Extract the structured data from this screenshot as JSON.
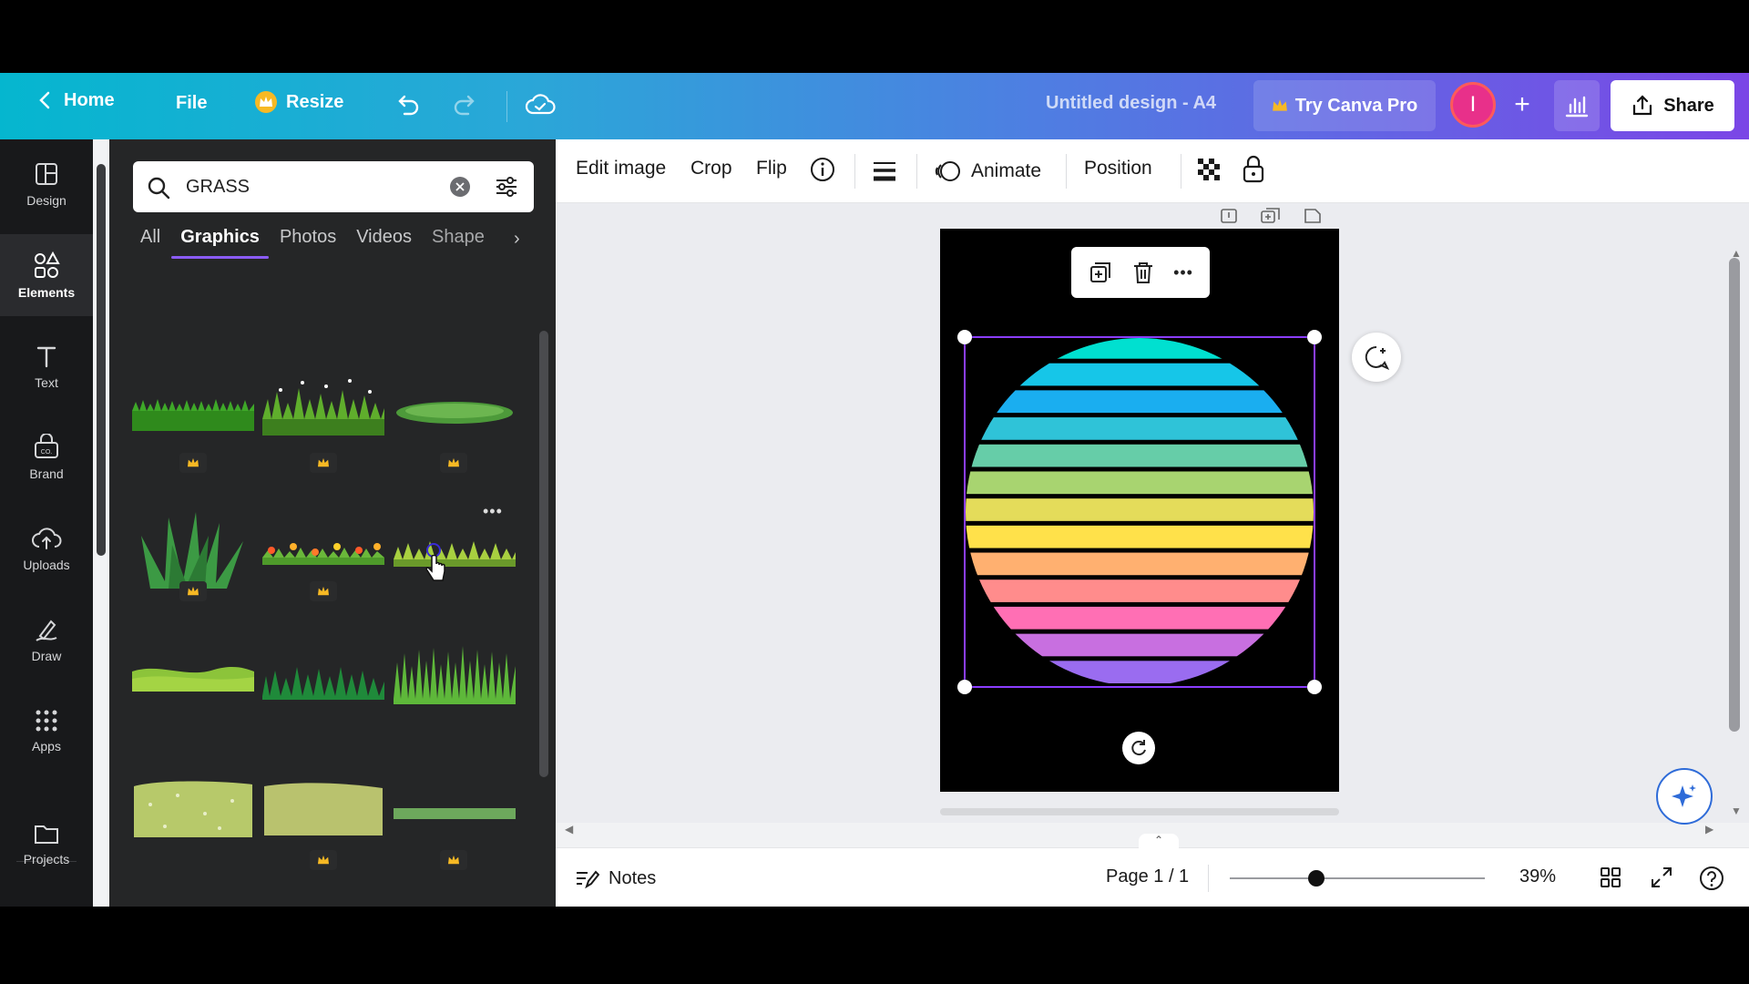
{
  "topbar": {
    "back_label": "Home",
    "file_label": "File",
    "resize_label": "Resize",
    "design_title": "Untitled design - A4",
    "try_pro_label": "Try Canva Pro",
    "avatar_initial": "I",
    "share_label": "Share"
  },
  "rail": {
    "items": [
      {
        "label": "Design",
        "icon": "layout-icon"
      },
      {
        "label": "Elements",
        "icon": "shapes-icon"
      },
      {
        "label": "Text",
        "icon": "text-icon"
      },
      {
        "label": "Brand",
        "icon": "brand-icon"
      },
      {
        "label": "Uploads",
        "icon": "upload-cloud-icon"
      },
      {
        "label": "Draw",
        "icon": "pen-icon"
      },
      {
        "label": "Apps",
        "icon": "grid-icon"
      },
      {
        "label": "Projects",
        "icon": "folder-icon"
      }
    ]
  },
  "panel": {
    "search_value": "GRASS",
    "tabs": [
      "All",
      "Graphics",
      "Photos",
      "Videos",
      "Shape"
    ],
    "active_tab": "Graphics"
  },
  "context_toolbar": {
    "edit_image": "Edit image",
    "crop": "Crop",
    "flip": "Flip",
    "animate": "Animate",
    "position": "Position"
  },
  "bottombar": {
    "notes_label": "Notes",
    "page_indicator": "Page 1 / 1",
    "zoom_value": "39%",
    "zoom_fraction": 0.39
  },
  "colors": {
    "accent": "#8b3dff",
    "topbar_start": "#05b6cf",
    "topbar_end": "#7b46e6",
    "panel_bg": "#252627",
    "stripes": [
      "#00e0d0",
      "#16c6e8",
      "#1aaef0",
      "#2fc3d8",
      "#66cda8",
      "#a8d470",
      "#e4dc5a",
      "#ffe14a",
      "#ffb070",
      "#ff8c8c",
      "#ff6fb4",
      "#c86fe0",
      "#9a6cf0"
    ]
  }
}
